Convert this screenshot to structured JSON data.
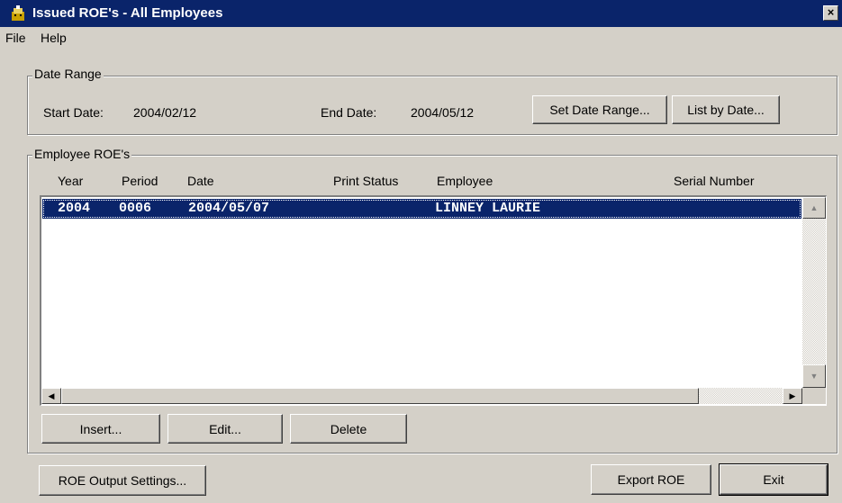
{
  "window": {
    "title": "Issued ROE's - All Employees",
    "close_label": "×"
  },
  "menu": {
    "file": "File",
    "help": "Help"
  },
  "date_range": {
    "group_label": "Date Range",
    "start_label": "Start Date:",
    "start_value": "2004/02/12",
    "end_label": "End Date:",
    "end_value": "2004/05/12",
    "set_btn": "Set Date Range...",
    "list_btn": "List by Date..."
  },
  "employees": {
    "group_label": "Employee ROE's",
    "columns": [
      "Year",
      "Period",
      "Date",
      "Print Status",
      "Employee",
      "Serial Number"
    ],
    "rows": [
      {
        "year": "2004",
        "period": "0006",
        "date": "2004/05/07",
        "print_status": "",
        "employee": "LINNEY LAURIE",
        "serial": ""
      }
    ],
    "insert_btn": "Insert...",
    "edit_btn": "Edit...",
    "delete_btn": "Delete"
  },
  "footer": {
    "settings_btn": "ROE Output Settings...",
    "export_btn": "Export ROE",
    "exit_btn": "Exit"
  },
  "colors": {
    "titlebar": "#0a246a",
    "face": "#d4d0c8",
    "selection": "#0a246a"
  }
}
